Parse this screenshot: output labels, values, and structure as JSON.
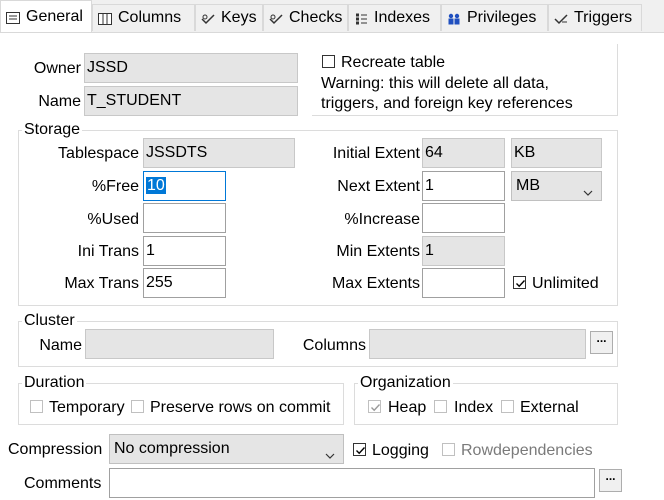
{
  "tabs": [
    {
      "label": "General",
      "icon": "general-tab-icon"
    },
    {
      "label": "Columns",
      "icon": "columns-tab-icon"
    },
    {
      "label": "Keys",
      "icon": "keys-tab-icon"
    },
    {
      "label": "Checks",
      "icon": "checks-tab-icon"
    },
    {
      "label": "Indexes",
      "icon": "indexes-tab-icon"
    },
    {
      "label": "Privileges",
      "icon": "privileges-tab-icon"
    },
    {
      "label": "Triggers",
      "icon": "triggers-tab-icon"
    }
  ],
  "general": {
    "owner_label": "Owner",
    "owner_value": "JSSD",
    "name_label": "Name",
    "name_value": "T_STUDENT",
    "recreate_label": "Recreate table",
    "warning_line1": "Warning: this will delete all data,",
    "warning_line2": "triggers, and foreign key references"
  },
  "storage": {
    "title": "Storage",
    "tablespace_label": "Tablespace",
    "tablespace_value": "JSSDTS",
    "free_label": "%Free",
    "free_value": "10",
    "used_label": "%Used",
    "used_value": "",
    "initrans_label": "Ini Trans",
    "initrans_value": "1",
    "maxtrans_label": "Max Trans",
    "maxtrans_value": "255",
    "initial_extent_label": "Initial Extent",
    "initial_extent_value": "64",
    "initial_extent_unit": "KB",
    "next_extent_label": "Next Extent",
    "next_extent_value": "1",
    "next_extent_unit": "MB",
    "increase_label": "%Increase",
    "increase_value": "",
    "min_extents_label": "Min Extents",
    "min_extents_value": "1",
    "max_extents_label": "Max Extents",
    "max_extents_value": "",
    "unlimited_label": "Unlimited",
    "unlimited_checked": true
  },
  "cluster": {
    "title": "Cluster",
    "name_label": "Name",
    "name_value": "",
    "columns_label": "Columns",
    "columns_value": "",
    "button_label": "..."
  },
  "duration": {
    "title": "Duration",
    "temporary_label": "Temporary",
    "preserve_label": "Preserve rows on commit"
  },
  "organization": {
    "title": "Organization",
    "heap_label": "Heap",
    "index_label": "Index",
    "external_label": "External"
  },
  "bottom": {
    "compression_label": "Compression",
    "compression_value": "No compression",
    "logging_label": "Logging",
    "rowdeps_label": "Rowdependencies",
    "comments_label": "Comments",
    "comments_value": "",
    "comments_button": "..."
  }
}
